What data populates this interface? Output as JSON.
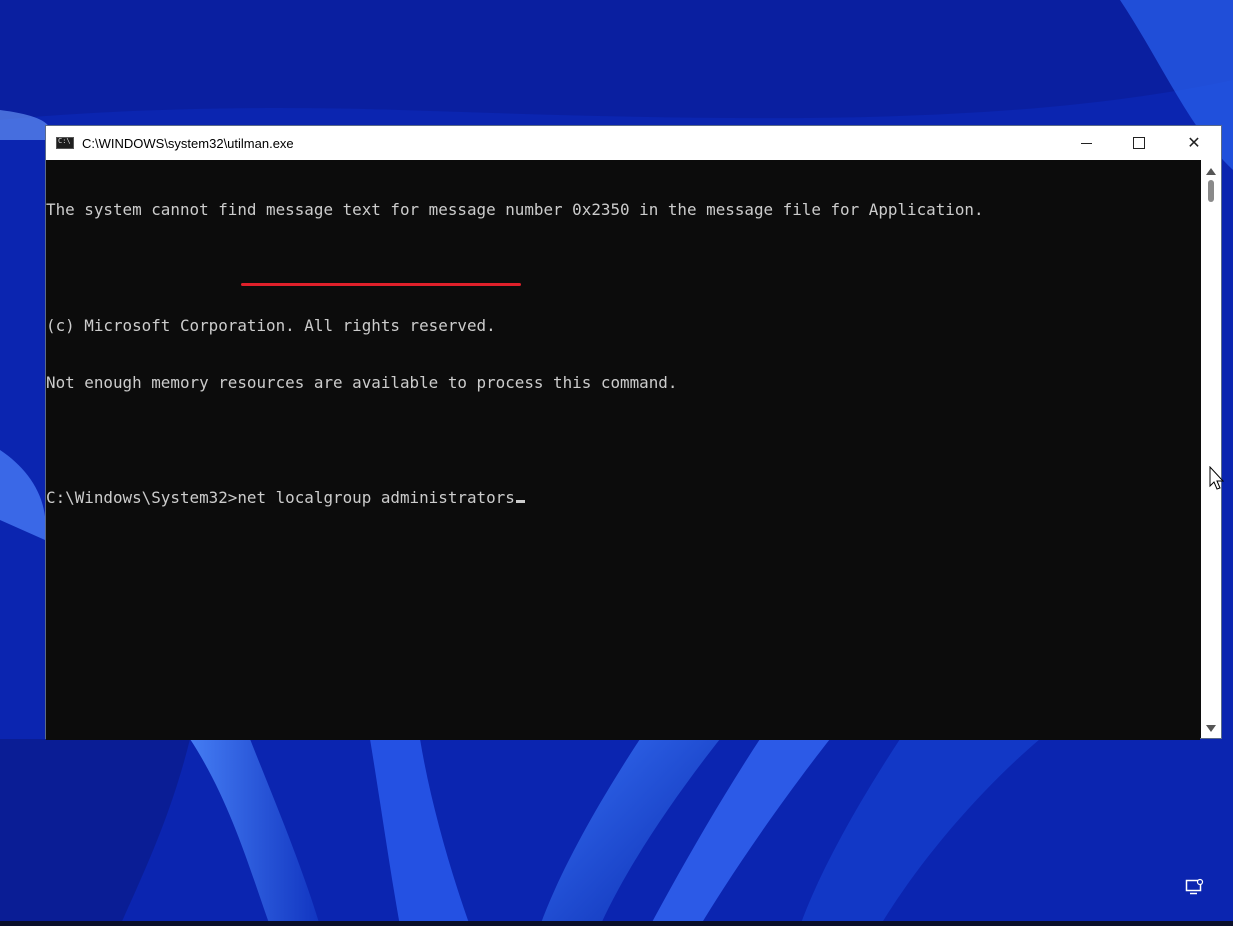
{
  "window": {
    "title": "C:\\WINDOWS\\system32\\utilman.exe",
    "minimize_label": "",
    "maximize_label": "",
    "close_label": "✕"
  },
  "console": {
    "lines": [
      "The system cannot find message text for message number 0x2350 in the message file for Application.",
      "",
      "(c) Microsoft Corporation. All rights reserved.",
      "Not enough memory resources are available to process this command.",
      "",
      "C:\\Windows\\System32>net localgroup administrators"
    ],
    "foreground_color": "#cccccc",
    "background_color": "#0c0c0c"
  },
  "annotation": {
    "underline_color": "#e0202a"
  },
  "icons": {
    "app": "cmd-icon",
    "tray": "network-display-icon"
  }
}
